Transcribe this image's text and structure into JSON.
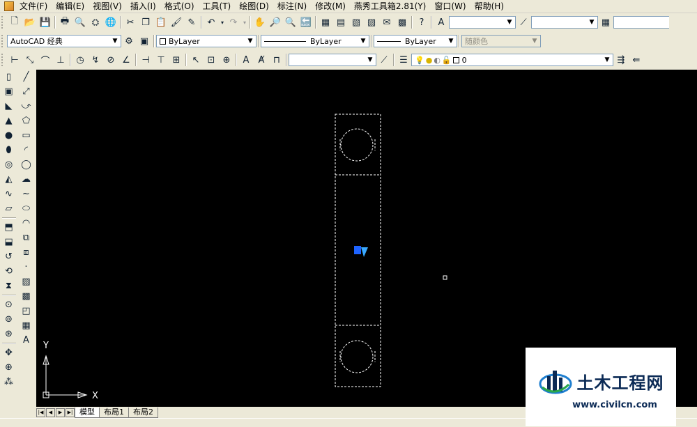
{
  "menu": [
    "文件(F)",
    "编辑(E)",
    "视图(V)",
    "插入(I)",
    "格式(O)",
    "工具(T)",
    "绘图(D)",
    "标注(N)",
    "修改(M)",
    "燕秀工具箱2.81(Y)",
    "窗口(W)",
    "帮助(H)"
  ],
  "toolbar2": {
    "workspace": "AutoCAD 经典",
    "color": "ByLayer",
    "linetype": "ByLayer",
    "lineweight": "ByLayer",
    "plotstyle": "随颜色"
  },
  "toolbar3": {
    "layer": "0"
  },
  "canvas": {
    "background": "#000000",
    "ucs_x_label": "X",
    "ucs_y_label": "Y"
  },
  "tabs": [
    "模型",
    "布局1",
    "布局2"
  ],
  "watermark": {
    "title": "土木工程网",
    "url": "www.civilcn.com"
  },
  "icons": [
    "app-icon",
    "new-icon",
    "open-icon",
    "save-icon",
    "print-icon",
    "undo-icon",
    "redo-icon",
    "pan-icon",
    "zoom-icon",
    "help-icon",
    "line-icon",
    "circle-icon",
    "arc-icon",
    "text-icon"
  ],
  "colors": {
    "accent": "#0b2a55",
    "dashed_outline": "#ffffff",
    "cursor_blue": "#1e63ff"
  }
}
